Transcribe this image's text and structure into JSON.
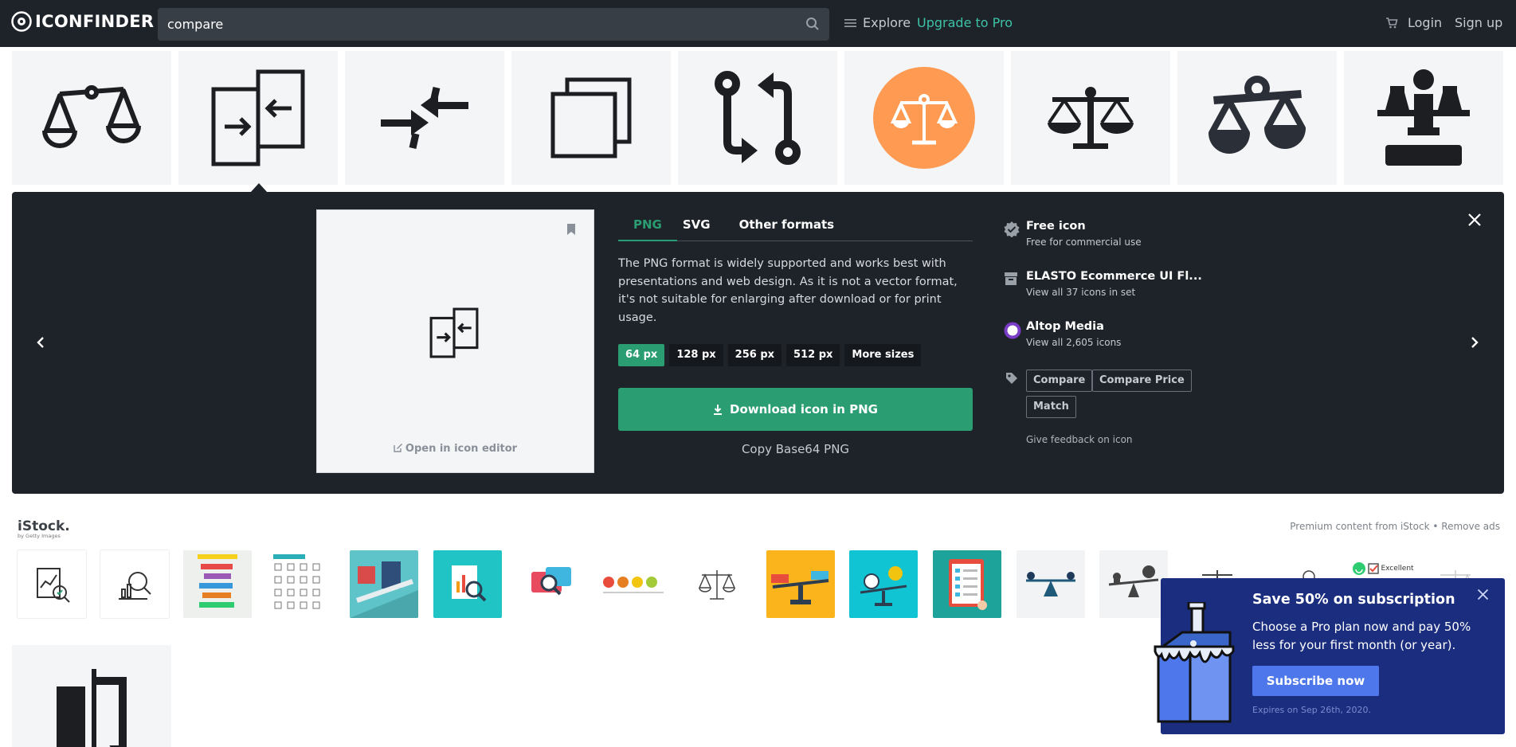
{
  "nav": {
    "logo_text": "ICONFINDER",
    "search_value": "compare",
    "explore": "Explore",
    "upgrade": "Upgrade to Pro",
    "login": "Login",
    "signup": "Sign up"
  },
  "results": [
    {
      "icon": "balance-scale-outline-icon",
      "selected": false
    },
    {
      "icon": "compare-arrows-pages-icon",
      "selected": true
    },
    {
      "icon": "arrows-converge-icon",
      "selected": false
    },
    {
      "icon": "overlapping-squares-icon",
      "selected": false
    },
    {
      "icon": "pull-request-arrows-icon",
      "selected": false
    },
    {
      "icon": "scale-orange-circle-icon",
      "selected": false
    },
    {
      "icon": "balance-scale-solid-icon",
      "selected": false
    },
    {
      "icon": "balance-scale-bold-icon",
      "selected": false
    },
    {
      "icon": "lawyer-podium-icon",
      "selected": false
    }
  ],
  "detail": {
    "open_editor": "Open in icon editor",
    "tabs": [
      "PNG",
      "SVG",
      "Other formats"
    ],
    "description": "The PNG format is widely supported and works best with presentations and web design. As it is not a vector format, it's not suitable for enlarging after download or for print usage.",
    "sizes": [
      "64 px",
      "128 px",
      "256 px",
      "512 px",
      "More sizes"
    ],
    "download": "Download icon in PNG",
    "copy": "Copy Base64 PNG",
    "free_title": "Free icon",
    "free_sub": "Free for commercial use",
    "set_title": "ELASTO Ecommerce UI Fl...",
    "set_sub": "View all 37 icons in set",
    "author_title": "Altop Media",
    "author_sub": "View all 2,605 icons",
    "tags": [
      "Compare",
      "Compare Price",
      "Match"
    ],
    "feedback": "Give feedback on icon"
  },
  "istock": {
    "logo": "iStock.",
    "logo_sub": "by Getty Images",
    "premium": "Premium content from iStock",
    "separator": "•",
    "remove": "Remove ads",
    "thumb_excellent": "Excellent"
  },
  "promo": {
    "title": "Save 50% on subscription",
    "text": "Choose a Pro plan now and pay 50% less for your first month (or year).",
    "button": "Subscribe now",
    "expires": "Expires on Sep 26th, 2020."
  },
  "colors": {
    "nav_bg": "#1e2329",
    "accent_green": "#2a9d72",
    "upgrade_teal": "#3cc3a7",
    "promo_bg": "#1b2d7e",
    "promo_button": "#4d77ea",
    "orange_icon": "#ff9a52"
  }
}
